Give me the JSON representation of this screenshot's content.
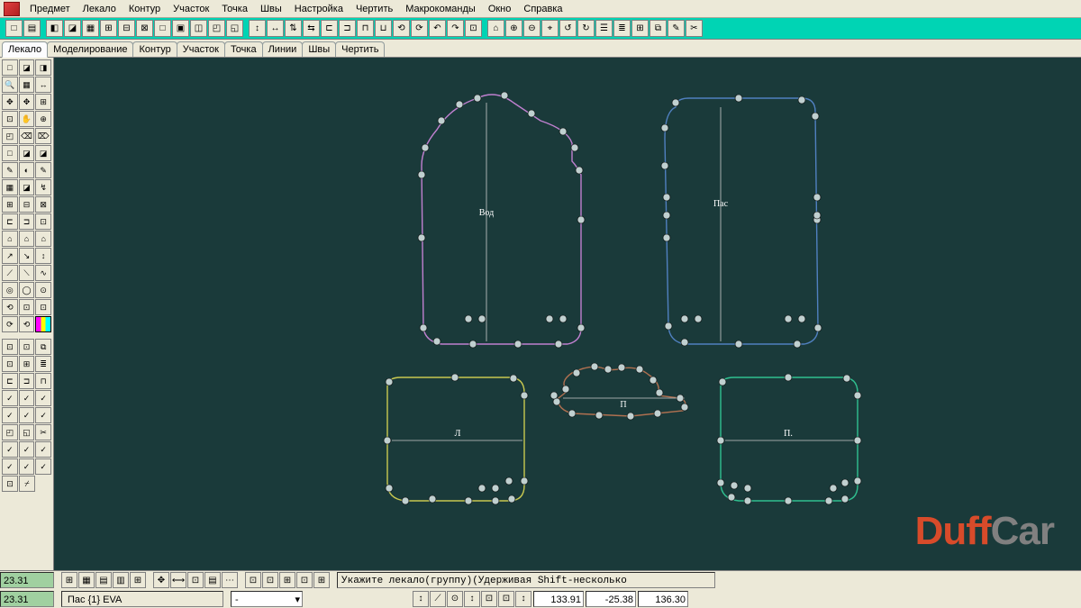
{
  "menu": {
    "items": [
      "Предмет",
      "Лекало",
      "Контур",
      "Участок",
      "Точка",
      "Швы",
      "Настройка",
      "Чертить",
      "Макрокоманды",
      "Окно",
      "Справка"
    ]
  },
  "tabs": {
    "items": [
      "Лекало",
      "Моделирование",
      "Контур",
      "Участок",
      "Точка",
      "Линии",
      "Швы",
      "Чертить"
    ],
    "active": 0
  },
  "canvas": {
    "shapes": [
      {
        "name": "vod",
        "label": "Вод",
        "color": "#c080d0"
      },
      {
        "name": "pas",
        "label": "Пас",
        "color": "#5080c0"
      },
      {
        "name": "l",
        "label": "Л",
        "color": "#c8c850"
      },
      {
        "name": "center",
        "label": "П",
        "color": "#b07050"
      },
      {
        "name": "p",
        "label": "П.",
        "color": "#30c090"
      }
    ]
  },
  "watermark": {
    "part1": "Duff",
    "part2": "Car"
  },
  "status": {
    "coord_y1": "23.31",
    "coord_y2": "23.31",
    "selection_info": "Пас {1} EVA",
    "prompt": "Укажите лекало(группу)(Удерживая Shift-несколько",
    "dropdown_value": "-",
    "num1": "133.91",
    "num2": "-25.38",
    "num3": "136.30"
  },
  "icons": {
    "generic_glyphs": [
      "□",
      "◧",
      "◪",
      "▦",
      "⊞",
      "✎",
      "↔",
      "⟲",
      "⊕",
      "▣",
      "⌖",
      "◎",
      "✂",
      "⌂",
      "⊡",
      "≡",
      "☰",
      "▤",
      "⊟",
      "⊠"
    ]
  }
}
